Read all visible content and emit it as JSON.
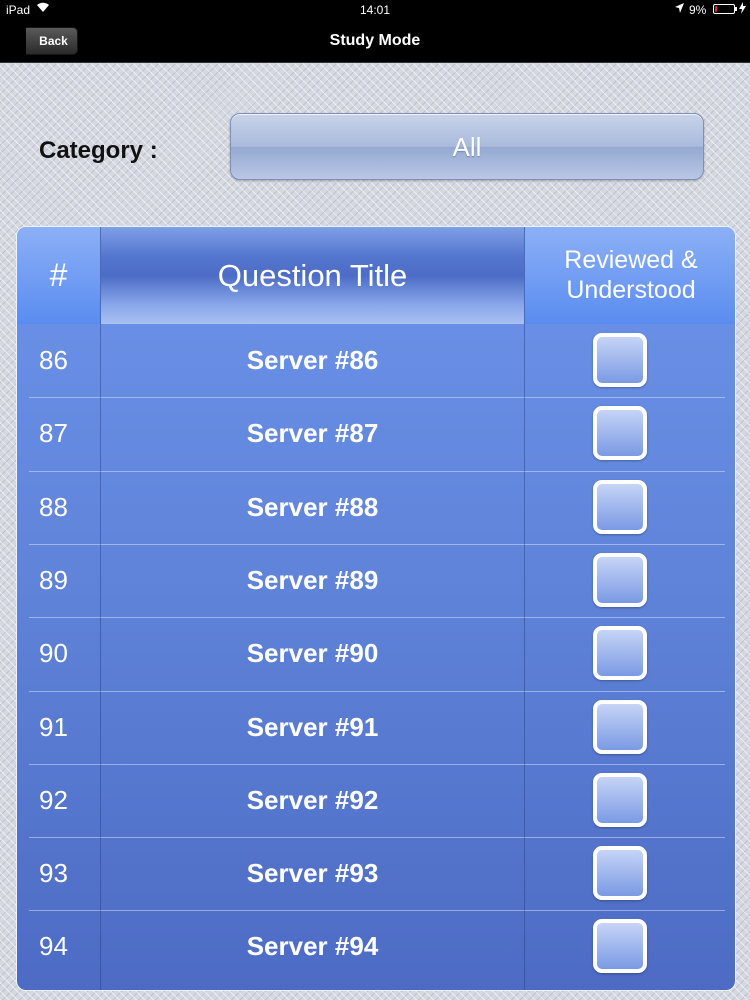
{
  "status_bar": {
    "device": "iPad",
    "time": "14:01",
    "battery_percent": "9%",
    "battery_level": 0.09,
    "battery_color": "#e0302a"
  },
  "nav": {
    "back_label": "Back",
    "title": "Study Mode"
  },
  "category": {
    "label": "Category :",
    "value": "All"
  },
  "table": {
    "headers": {
      "number": "#",
      "title": "Question Title",
      "reviewed_line1": "Reviewed &",
      "reviewed_line2": "Understood"
    },
    "rows": [
      {
        "number": "86",
        "title": "Server #86",
        "reviewed": false
      },
      {
        "number": "87",
        "title": "Server #87",
        "reviewed": false
      },
      {
        "number": "88",
        "title": "Server #88",
        "reviewed": false
      },
      {
        "number": "89",
        "title": "Server #89",
        "reviewed": false
      },
      {
        "number": "90",
        "title": "Server #90",
        "reviewed": false
      },
      {
        "number": "91",
        "title": "Server #91",
        "reviewed": false
      },
      {
        "number": "92",
        "title": "Server #92",
        "reviewed": false
      },
      {
        "number": "93",
        "title": "Server #93",
        "reviewed": false
      },
      {
        "number": "94",
        "title": "Server #94",
        "reviewed": false
      }
    ]
  },
  "icons": {
    "wifi": "wifi-icon",
    "location": "location-arrow-icon",
    "battery": "battery-icon",
    "charging": "charging-bolt-icon"
  },
  "colors": {
    "table_blue": "#5e82d8",
    "header_blue": "#5a8cf0"
  }
}
